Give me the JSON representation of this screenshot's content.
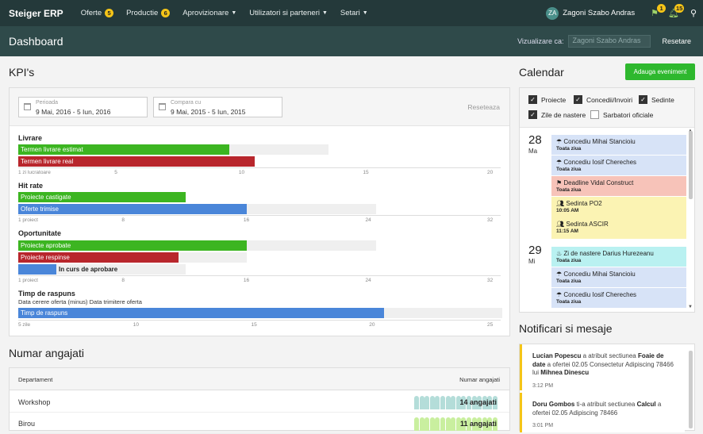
{
  "nav": {
    "brand": "Steiger ERP",
    "items": [
      {
        "label": "Oferte",
        "badge": "5"
      },
      {
        "label": "Productie",
        "badge": "6"
      },
      {
        "label": "Aprovizionare",
        "badge": null
      },
      {
        "label": "Utilizatori si parteneri",
        "badge": null
      },
      {
        "label": "Setari",
        "badge": null
      }
    ],
    "avatar": "ZA",
    "user": "Zagoni Szabo Andras",
    "flag_badge": "1",
    "bell_badge": "15"
  },
  "header": {
    "title": "Dashboard",
    "view_as_label": "Vizualizare ca:",
    "view_as_value": "Zagoni Szabo Andras",
    "reset_label": "Resetare"
  },
  "kpi": {
    "title": "KPI's",
    "period_label": "Perioada",
    "period_value": "9 Mai, 2016 - 5 Iun, 2016",
    "compare_label": "Compara cu",
    "compare_value": "9 Mai, 2015 - 5 Iun, 2015",
    "reset_link": "Reseteaza",
    "groups": {
      "livrare": {
        "title": "Livrare",
        "bars": [
          {
            "label": "Termen livrare estimat",
            "value": 9.5,
            "compare": 13.5,
            "color": "#3cb521"
          },
          {
            "label": "Termen livrare real",
            "value": 10.5,
            "compare": null,
            "color": "#b8262c"
          }
        ],
        "ticks": [
          "1 zi lucratoare",
          "5",
          "10",
          "15",
          "20"
        ]
      },
      "hitrate": {
        "title": "Hit rate",
        "bars": [
          {
            "label": "Proiecte castigate",
            "value": 12,
            "compare": null,
            "color": "#3cb521"
          },
          {
            "label": "Oferte trimise",
            "value": 16,
            "compare": 24.5,
            "color": "#4a86d9"
          }
        ],
        "ticks": [
          "1 proiect",
          "8",
          "16",
          "24",
          "32"
        ]
      },
      "oportunitate": {
        "title": "Oportunitate",
        "bars": [
          {
            "label": "Proiecte aprobate",
            "value": 16,
            "compare": 24.5,
            "color": "#3cb521"
          },
          {
            "label": "Proiecte respinse",
            "value": 11.5,
            "compare": 16,
            "color": "#b8262c"
          },
          {
            "label": "In curs de aprobare",
            "value": 3.5,
            "compare": 12,
            "color": "#4a86d9"
          }
        ],
        "ticks": [
          "1 proiect",
          "8",
          "16",
          "24",
          "32"
        ]
      },
      "timp": {
        "title": "Timp de raspuns",
        "subtitle": "Data cerere oferta (minus) Data trimitere oferta",
        "bars": [
          {
            "label": "Timp de raspuns",
            "value": 20.5,
            "compare": 25.5,
            "color": "#4a86d9"
          }
        ],
        "ticks": [
          "5 zile",
          "10",
          "15",
          "20",
          "25"
        ]
      }
    }
  },
  "employees": {
    "title": "Numar angajati",
    "col_dept": "Departament",
    "col_count": "Numar angajati",
    "rows": [
      {
        "dept": "Workshop",
        "count": "14 angajati",
        "color": "#b4ddd9"
      },
      {
        "dept": "Birou",
        "count": "11 angajati",
        "color": "#c9ef9f"
      }
    ]
  },
  "calendar": {
    "title": "Calendar",
    "add_button": "Adauga eveniment",
    "filters": [
      {
        "label": "Proiecte",
        "checked": true
      },
      {
        "label": "Concedii/Invoiri",
        "checked": true
      },
      {
        "label": "Sedinte",
        "checked": true
      },
      {
        "label": "Zile de nastere",
        "checked": true
      },
      {
        "label": "Sarbatori oficiale",
        "checked": false
      }
    ],
    "days": [
      {
        "num": "28",
        "name": "Ma",
        "events": [
          {
            "icon": "umbrella-icon",
            "title": "Concediu Mihai Stancioiu",
            "sub": "Toata ziua",
            "color": "blue"
          },
          {
            "icon": "umbrella-icon",
            "title": "Concediu Iosif Chereches",
            "sub": "Toata ziua",
            "color": "blue"
          },
          {
            "icon": "flag-icon",
            "title": "Deadline Vidal Construct",
            "sub": "Toata ziua",
            "color": "red"
          },
          {
            "icon": "people-icon",
            "title": "Sedinta PO2",
            "sub": "10:05 AM",
            "color": "yellow"
          },
          {
            "icon": "people-icon",
            "title": "Sedinta ASCIR",
            "sub": "11:15 AM",
            "color": "yellow"
          }
        ]
      },
      {
        "num": "29",
        "name": "Mi",
        "events": [
          {
            "icon": "cake-icon",
            "title": "Zi de nastere Darius Hurezeanu",
            "sub": "Toata ziua",
            "color": "cyan"
          },
          {
            "icon": "umbrella-icon",
            "title": "Concediu Mihai Stancioiu",
            "sub": "Toata ziua",
            "color": "blue"
          },
          {
            "icon": "umbrella-icon",
            "title": "Concediu Iosif Chereches",
            "sub": "Toata ziua",
            "color": "blue"
          }
        ]
      }
    ]
  },
  "notifications": {
    "title": "Notificari si mesaje",
    "items": [
      {
        "who": "Lucian Popescu",
        "t1": " a atribuit sectiunea ",
        "what": "Foaie de date",
        "t2": " a ofertei 02.05 Consectetur Adipiscing 78466 lui ",
        "to": "Mihnea Dinescu",
        "time": "3:12 PM"
      },
      {
        "who": "Doru Gombos",
        "t1": " ti-a atribuit sectiunea ",
        "what": "Calcul",
        "t2": " a ofertei 02.05 Adipiscing 78466",
        "to": "",
        "time": "3:01 PM"
      }
    ]
  }
}
